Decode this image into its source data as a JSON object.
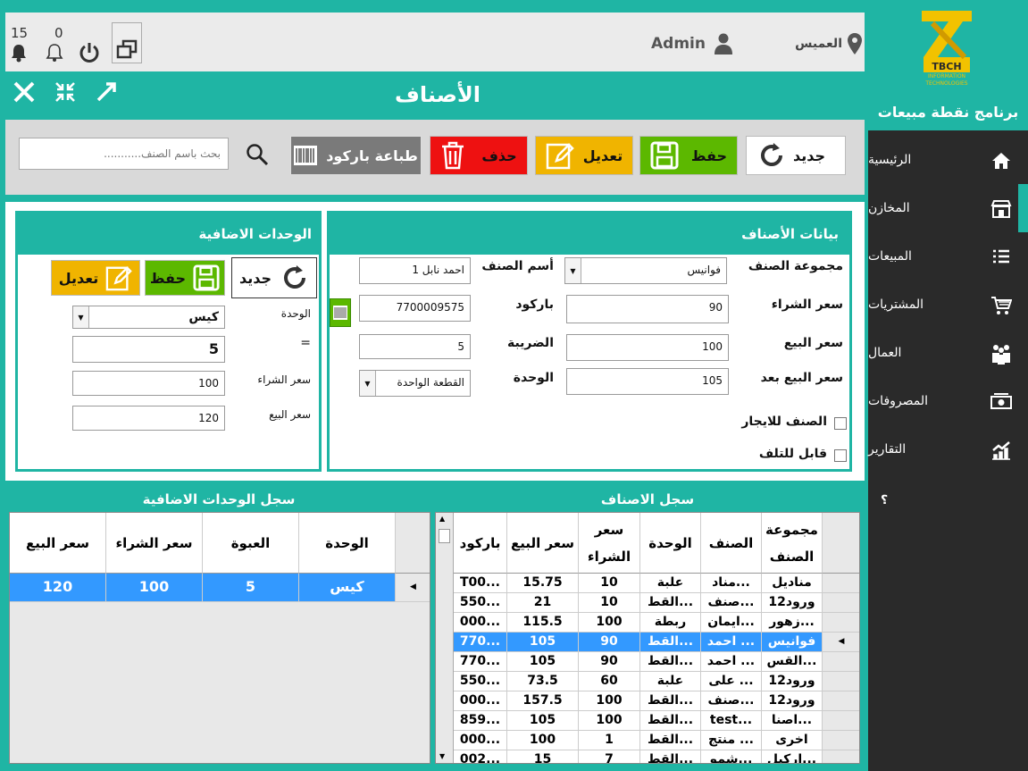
{
  "app": {
    "title": "برنامج نقطة مبيعات",
    "logo_text": "TBCH",
    "logo_sub1": "INFORMATION",
    "logo_sub2": "TECHNOLOGIES"
  },
  "header": {
    "location": "العميس",
    "user": "Admin",
    "notif_count": "15",
    "alert_count": "0"
  },
  "page": {
    "title": "الأصناف"
  },
  "sidebar": {
    "items": [
      {
        "label": "الرئيسية",
        "icon": "home-icon"
      },
      {
        "label": "المخازن",
        "icon": "store-icon"
      },
      {
        "label": "المبيعات",
        "icon": "list-icon"
      },
      {
        "label": "المشتريات",
        "icon": "cart-icon"
      },
      {
        "label": "العمال",
        "icon": "workers-icon"
      },
      {
        "label": "المصروفات",
        "icon": "money-icon"
      },
      {
        "label": "التقارير",
        "icon": "chart-icon"
      }
    ],
    "help": "؟"
  },
  "toolbar": {
    "new_label": "جديد",
    "save_label": "حفظ",
    "edit_label": "تعديل",
    "delete_label": "حذف",
    "print_barcode_label": "طباعة باركود",
    "search_placeholder": "بحث باسم الصنف..........."
  },
  "item_form": {
    "title": "بيانات الأصناف",
    "group_label": "مجموعة الصنف",
    "group_value": "فوانيس",
    "name_label": "أسم الصنف",
    "name_value": "احمد نابل 1",
    "buy_label": "سعر الشراء",
    "buy_value": "90",
    "barcode_label": "باركود",
    "barcode_value": "7700009575",
    "sell_label": "سعر البيع",
    "sell_value": "100",
    "tax_label": "الضريبة",
    "tax_value": "5",
    "sell_after_label": "سعر البيع بعد",
    "sell_after_value": "105",
    "unit_label": "الوحدة",
    "unit_value": "القطعة الواحدة",
    "rent_label": "الصنف للايجار",
    "damage_label": "قابل للتلف"
  },
  "units_form": {
    "title": "الوحدات الاضافية",
    "new_label": "جديد",
    "save_label": "حفظ",
    "edit_label": "تعديل",
    "unit_label": "الوحدة",
    "unit_value": "كيس",
    "eq_label": "=",
    "eq_value": "5",
    "buy_label": "سعر الشراء",
    "buy_value": "100",
    "sell_label": "سعر البيع",
    "sell_value": "120"
  },
  "items_grid": {
    "title": "سجل الاصناف",
    "headers": [
      "مجموعة الصنف",
      "الصنف",
      "الوحدة",
      "سعر الشراء",
      "سعر البيع",
      "باركود"
    ],
    "rows": [
      [
        "مناديل",
        "مناد...",
        "علبة",
        "10",
        "15.75",
        "T00..."
      ],
      [
        "ورود12",
        "صنف...",
        "القط...",
        "10",
        "21",
        "550..."
      ],
      [
        "زهور...",
        "ايمان...",
        "ربطة",
        "100",
        "115.5",
        "000..."
      ],
      [
        "فوانيس",
        "احمد ...",
        "القط...",
        "90",
        "105",
        "770..."
      ],
      [
        "القس...",
        "احمد ...",
        "القط...",
        "90",
        "105",
        "770..."
      ],
      [
        "ورود12",
        "على ...",
        "علبة",
        "60",
        "73.5",
        "550..."
      ],
      [
        "ورود12",
        "صنف...",
        "القط...",
        "100",
        "157.5",
        "000..."
      ],
      [
        "اصنا...",
        "test...",
        "القط...",
        "100",
        "105",
        "859..."
      ],
      [
        "اخرى",
        "منتج ...",
        "القط...",
        "1",
        "100",
        "000..."
      ],
      [
        "اركيل...",
        "شمو...",
        "القط...",
        "7",
        "15",
        "002..."
      ]
    ],
    "selected_index": 3
  },
  "units_grid": {
    "title": "سجل الوحدات الاضافية",
    "headers": [
      "الوحدة",
      "العبوة",
      "سعر الشراء",
      "سعر البيع"
    ],
    "rows": [
      [
        "كيس",
        "5",
        "100",
        "120"
      ]
    ]
  },
  "colors": {
    "accent": "#1fb5a4",
    "sidebar": "#2a2a2a",
    "save": "#5cb800",
    "edit": "#f0b400",
    "delete": "#ee1111",
    "print": "#7a7a7a",
    "selection": "#3399ff"
  }
}
